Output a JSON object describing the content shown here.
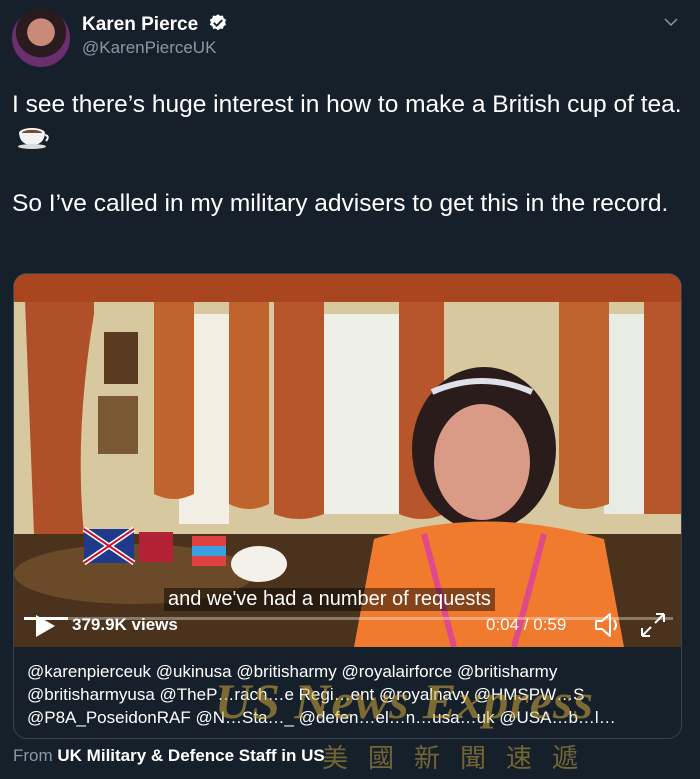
{
  "author": {
    "name": "Karen Pierce",
    "handle": "@KarenPierceUK",
    "avatar_icon": "profile-photo",
    "verified_icon": "verified-badge-icon"
  },
  "tweet": {
    "line1": "I see there’s huge interest in how to make a British cup of tea.",
    "line2": "So I’ve called in my military advisers to get this in the record.",
    "emoji": "hot-beverage-icon"
  },
  "video": {
    "caption": "and we've had a number of requests",
    "views": "379.9K views",
    "time": "0:04 / 0:59",
    "progress": 0.068,
    "play_icon": "play-icon",
    "volume_icon": "volume-icon",
    "fullscreen_icon": "expand-icon"
  },
  "card_text": "@karenpierceuk @ukinusa @britisharmy @royalairforce @britisharmy @britisharmyusa @TheP…rach…e Regi…ent @royalnavy @HMSPW…S @P8A_PoseidonRAF @N…Sta…_ @defen…el…n…usa…uk @USA…b…l…",
  "from": {
    "prefix": "From",
    "source": "UK Military & Defence Staff in US"
  },
  "watermark": {
    "text": "US News Express",
    "chinese": "美國新聞速遞"
  },
  "colors": {
    "background": "#15202b",
    "secondary_text": "#8899a6",
    "border": "#38444d",
    "verified": "#ffffff"
  }
}
